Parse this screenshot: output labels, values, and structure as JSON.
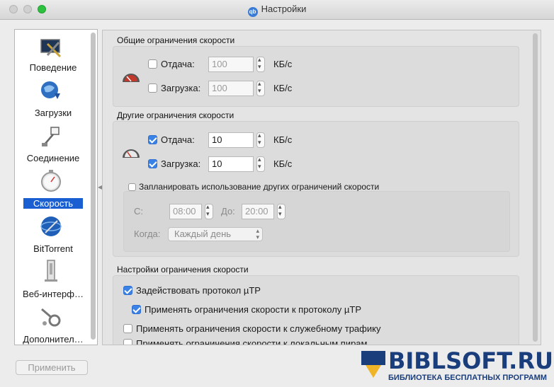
{
  "window": {
    "title": "Настройки"
  },
  "sidebar": {
    "items": [
      {
        "label": "Поведение",
        "icon": "monitor-tools-icon"
      },
      {
        "label": "Загрузки",
        "icon": "globe-download-icon"
      },
      {
        "label": "Соединение",
        "icon": "network-plug-icon"
      },
      {
        "label": "Скорость",
        "icon": "stopwatch-icon",
        "selected": true
      },
      {
        "label": "BitTorrent",
        "icon": "bittorrent-globe-icon"
      },
      {
        "label": "Веб-интерф…",
        "icon": "server-tower-icon"
      },
      {
        "label": "Дополнител…",
        "icon": "wrench-gears-icon"
      }
    ]
  },
  "global_limits": {
    "title": "Общие ограничения скорости",
    "upload": {
      "label": "Отдача:",
      "checked": false,
      "value": "100",
      "unit": "КБ/с"
    },
    "download": {
      "label": "Загрузка:",
      "checked": false,
      "value": "100",
      "unit": "КБ/с"
    }
  },
  "alt_limits": {
    "title": "Другие ограничения скорости",
    "upload": {
      "label": "Отдача:",
      "checked": true,
      "value": "10",
      "unit": "КБ/с"
    },
    "download": {
      "label": "Загрузка:",
      "checked": true,
      "value": "10",
      "unit": "КБ/с"
    },
    "schedule": {
      "label": "Запланировать использование других ограничений скорости",
      "checked": false,
      "from_label": "С:",
      "from_value": "08:00",
      "to_label": "До:",
      "to_value": "20:00",
      "when_label": "Когда:",
      "when_value": "Каждый день"
    }
  },
  "settings": {
    "title": "Настройки ограничения скорости",
    "utp": {
      "label": "Задействовать протокол µTP",
      "checked": true
    },
    "utp_limits": {
      "label": "Применять ограничения скорости к протоколу µTP",
      "checked": true
    },
    "overhead": {
      "label": "Применять ограничения скорости к служебному трафику",
      "checked": false
    },
    "lan": {
      "label": "Применять ограничения скорости к локальным пирам",
      "checked": false
    }
  },
  "footer": {
    "apply_label": "Применить"
  },
  "watermark": {
    "text": "BIBLSOFT.RU",
    "subtitle": "БИБЛИОТЕКА БЕСПЛАТНЫХ ПРОГРАММ"
  },
  "colors": {
    "accent": "#1a5fd2",
    "checkbox": "#3b82e6",
    "watermark": "#1a3d7c"
  }
}
